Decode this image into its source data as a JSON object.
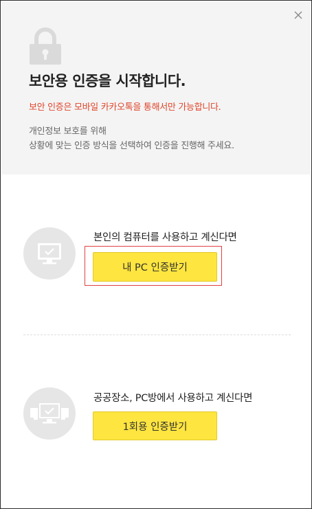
{
  "header": {
    "title": "보안용 인증을 시작합니다.",
    "notice": "보안 인증은 모바일 카카오톡을 통해서만 가능합니다.",
    "description_line1": "개인정보 보호를 위해",
    "description_line2": "상황에 맞는 인증 방식을 선택하여 인증을 진행해 주세요."
  },
  "icons": {
    "close": "close-icon",
    "lock": "lock-icon",
    "my_pc": "monitor-icon",
    "public_pc": "multi-monitor-icon"
  },
  "options": {
    "my_pc": {
      "text": "본인의 컴퓨터를 사용하고 계신다면",
      "button_label": "내 PC 인증받기"
    },
    "one_time": {
      "text": "공공장소, PC방에서 사용하고 계신다면",
      "button_label": "1회용 인증받기"
    }
  },
  "colors": {
    "accent_yellow": "#fee53f",
    "notice_red": "#e0452b",
    "highlight_red": "#e04040",
    "header_bg": "#f4f4f4"
  }
}
